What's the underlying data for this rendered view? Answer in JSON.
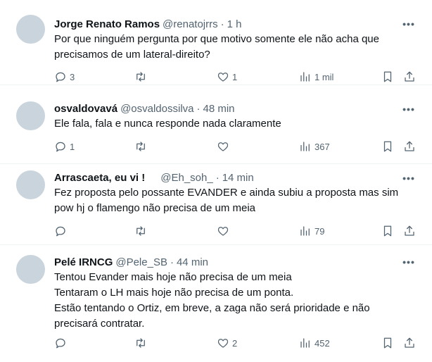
{
  "tweets": [
    {
      "name": "Jorge Renato Ramos",
      "handle": "@renatojrrs",
      "dot": "·",
      "time": "1 h",
      "lines": [
        "Por que ninguém pergunta por que motivo somente ele não acha que",
        "precisamos de um lateral-direito?"
      ],
      "reply_count": "3",
      "retweet_count": "",
      "like_count": "1",
      "view_count": "1 mil"
    },
    {
      "name": "osvaldovavá",
      "handle": "@osvaldossilva",
      "dot": "·",
      "time": "48 min",
      "lines": [
        "Ele fala, fala e nunca responde nada claramente"
      ],
      "reply_count": "1",
      "retweet_count": "",
      "like_count": "",
      "view_count": "367"
    },
    {
      "name": "Arrascaeta, eu vi !",
      "handle": "@Eh_soh_",
      "dot": "·",
      "time": "14 min",
      "lines": [
        "Fez proposta pelo possante EVANDER e ainda subiu a proposta mas sim",
        "pow hj o flamengo não precisa de um meia"
      ],
      "reply_count": "",
      "retweet_count": "",
      "like_count": "",
      "view_count": "79"
    },
    {
      "name": "Pelé IRNCG",
      "handle": "@Pele_SB",
      "dot": "·",
      "time": "44 min",
      "lines": [
        "Tentou Evander mais hoje não precisa de um meia",
        "Tentaram o LH mais hoje não precisa de um ponta.",
        "Estão tentando o Ortiz, em breve, a zaga não será prioridade e não",
        "precisará contratar."
      ],
      "reply_count": "",
      "retweet_count": "",
      "like_count": "2",
      "view_count": "452"
    }
  ],
  "icons": {
    "more": "more-icon",
    "reply": "reply-icon",
    "retweet": "retweet-icon",
    "like": "heart-icon",
    "views": "views-icon",
    "bookmark": "bookmark-icon",
    "share": "share-icon"
  },
  "colors": {
    "text": "#0f1419",
    "secondary": "#536471",
    "divider": "#eff3f4",
    "avatar": "#c9d4dc"
  }
}
